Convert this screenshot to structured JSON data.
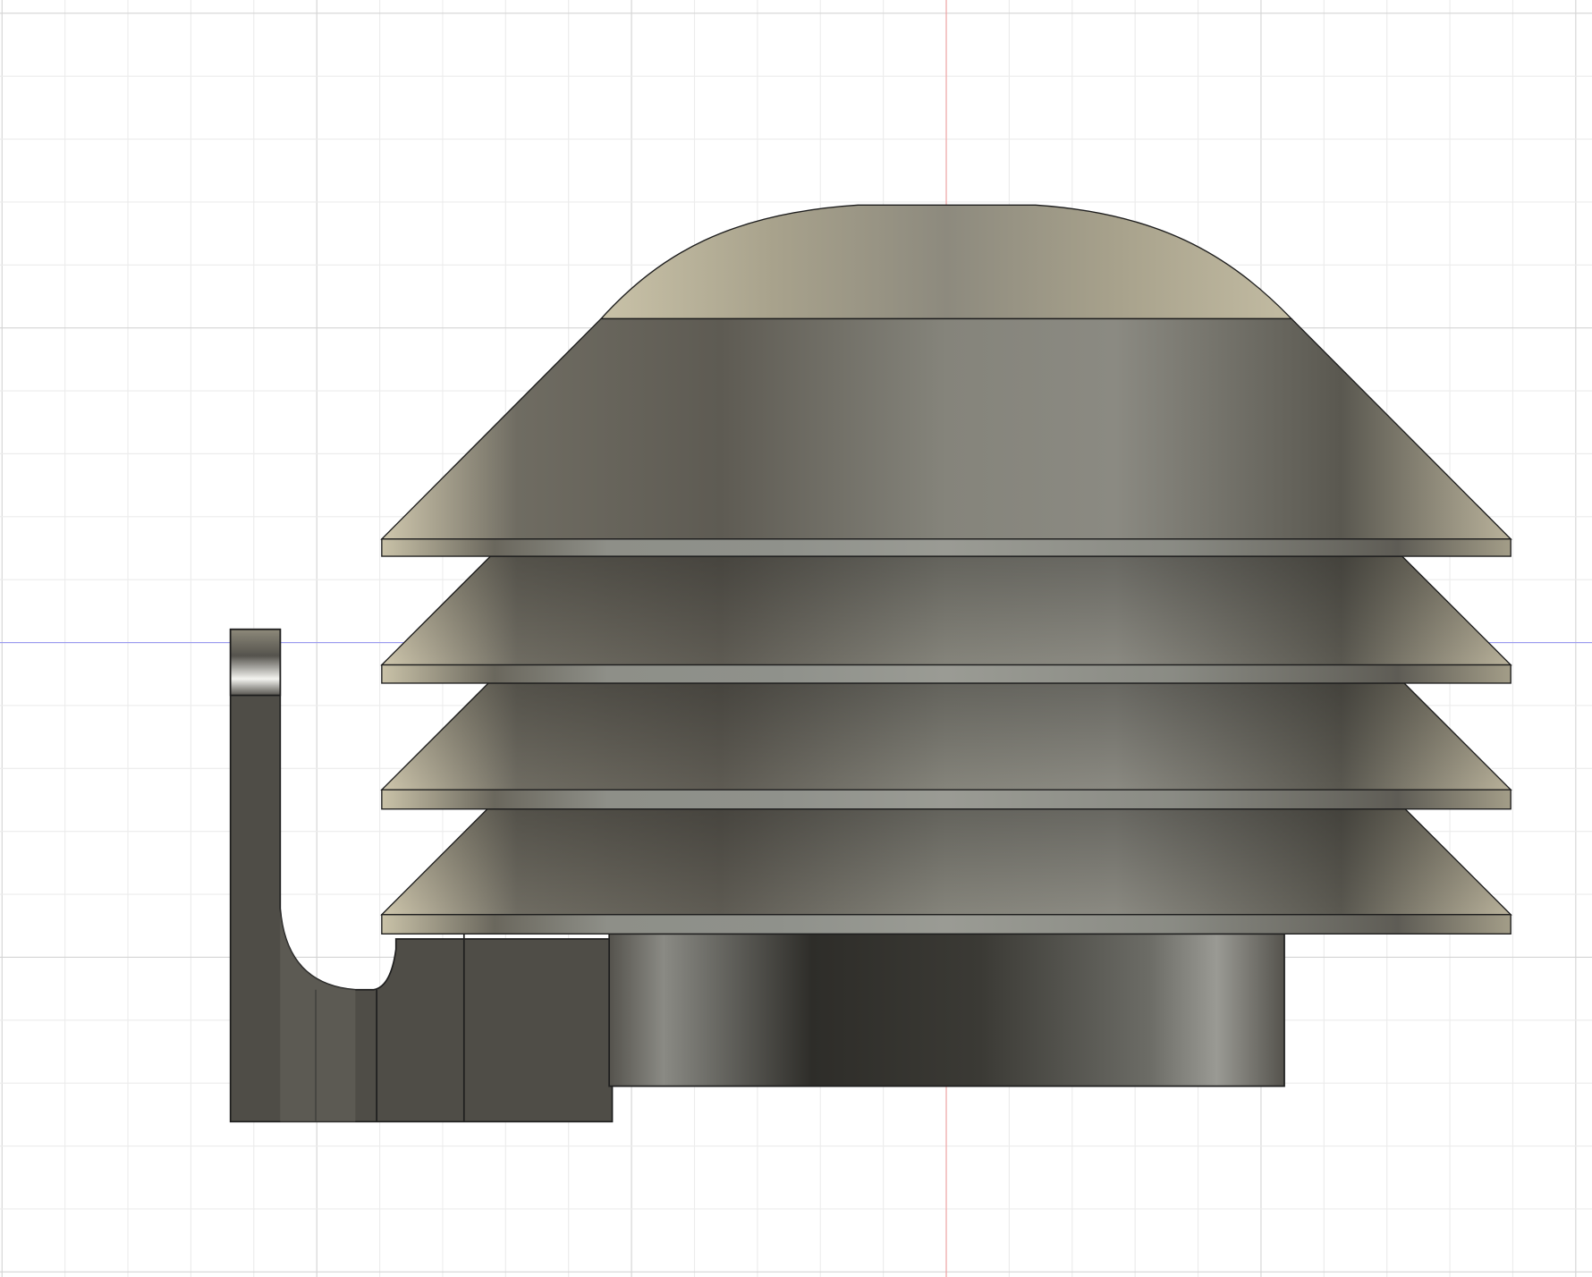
{
  "viewport": {
    "colors": {
      "background": "#ffffff",
      "grid_minor": "#ececec",
      "grid_major": "#d4d4d4",
      "axis_vertical": "#f0a0a0",
      "axis_horizontal": "#9a9af0",
      "body_dark": "#3a3833",
      "body_mid": "#7c7a70",
      "body_light": "#c9c2a8",
      "edge": "#1e1e1e"
    }
  }
}
